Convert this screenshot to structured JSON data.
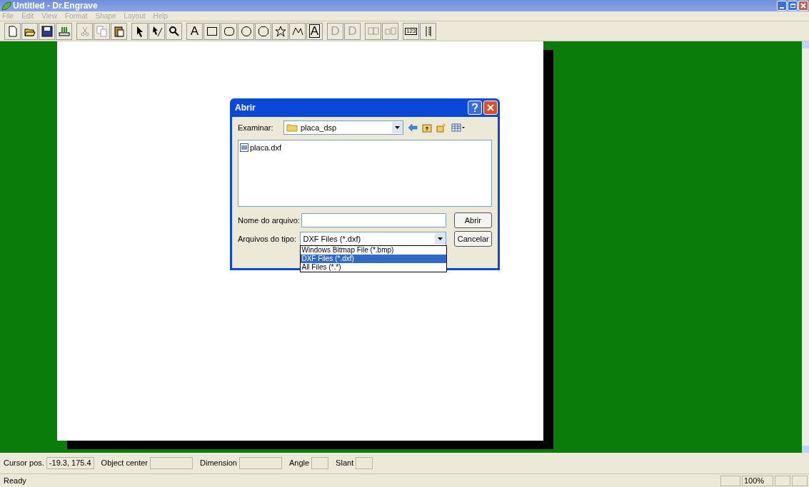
{
  "window": {
    "title": "Untitled - Dr.Engrave"
  },
  "menu": [
    "File",
    "Edit",
    "View",
    "Format",
    "Shape",
    "Layout",
    "Help"
  ],
  "toolbar": [
    {
      "kind": "new",
      "disabled": false
    },
    {
      "kind": "open",
      "disabled": false
    },
    {
      "kind": "save",
      "disabled": false
    },
    {
      "kind": "scan",
      "disabled": false
    },
    {
      "kind": "sep"
    },
    {
      "kind": "cut",
      "disabled": true
    },
    {
      "kind": "copy",
      "disabled": true
    },
    {
      "kind": "paste",
      "disabled": false
    },
    {
      "kind": "sep"
    },
    {
      "kind": "pointer",
      "disabled": false
    },
    {
      "kind": "node",
      "disabled": false
    },
    {
      "kind": "zoom",
      "disabled": false
    },
    {
      "kind": "sep"
    },
    {
      "kind": "text",
      "label": "A",
      "disabled": false
    },
    {
      "kind": "rect",
      "disabled": false
    },
    {
      "kind": "roundrect",
      "disabled": false
    },
    {
      "kind": "ellipse",
      "disabled": false
    },
    {
      "kind": "polygon",
      "disabled": false
    },
    {
      "kind": "star",
      "disabled": false
    },
    {
      "kind": "polyline",
      "disabled": false
    },
    {
      "kind": "textbox",
      "label": "A",
      "disabled": false
    },
    {
      "kind": "sep"
    },
    {
      "kind": "letter",
      "label": "D",
      "disabled": true
    },
    {
      "kind": "letter",
      "label": "D",
      "disabled": true
    },
    {
      "kind": "sep"
    },
    {
      "kind": "group",
      "disabled": true
    },
    {
      "kind": "ungroup",
      "disabled": true
    },
    {
      "kind": "sep"
    },
    {
      "kind": "numbers",
      "label": "123",
      "disabled": false
    },
    {
      "kind": "bars",
      "disabled": false
    }
  ],
  "dialog": {
    "title": "Abrir",
    "look_in": {
      "label": "Examinar:",
      "value": "placa_dsp"
    },
    "files": [
      {
        "name": "placa.dxf",
        "selected": false
      }
    ],
    "filename": {
      "label": "Nome do arquivo:"
    },
    "filetype": {
      "label": "Arquivos do tipo:",
      "value": "DXF Files (*.dxf)",
      "options": [
        {
          "label": "Windows Bitmap File (*.bmp)",
          "selected": false
        },
        {
          "label": "DXF Files (*.dxf)",
          "selected": true
        },
        {
          "label": "All Files (*.*)",
          "selected": false
        }
      ]
    },
    "buttons": [
      "Abrir",
      "Cancelar"
    ]
  },
  "status": [
    {
      "label": "Cursor pos.",
      "value": "-19.3, 175.4"
    },
    {
      "label": "Object center"
    },
    {
      "label": "Dimension"
    },
    {
      "label": "Angle"
    },
    {
      "label": "Slant"
    }
  ],
  "status_bar": {
    "message": "Ready",
    "zoom": "100%"
  }
}
